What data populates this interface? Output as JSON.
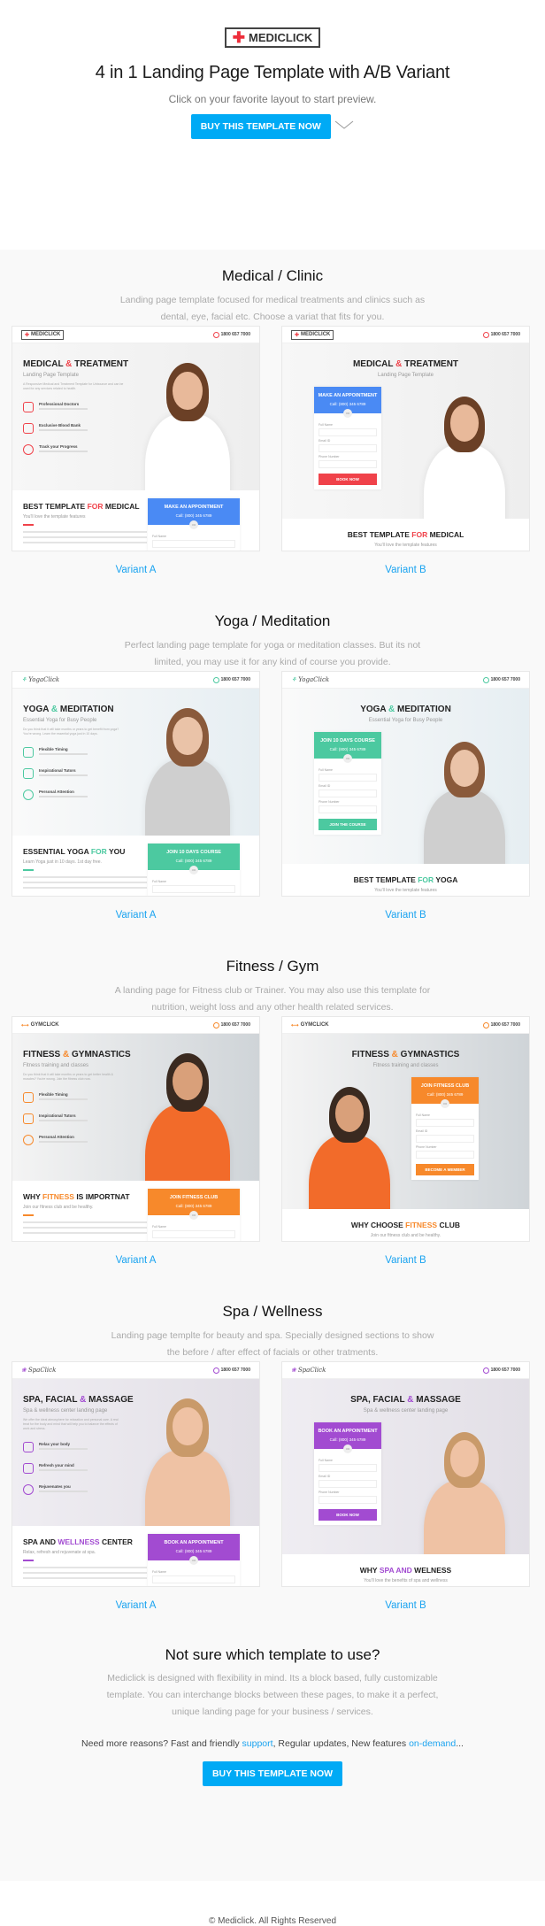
{
  "header": {
    "logo": "MEDICLICK",
    "title": "4 in 1 Landing Page Template with A/B Variant",
    "subtitle": "Click on your favorite layout to start preview.",
    "cta": "BUY THIS TEMPLATE NOW",
    "scroll_icon": "chevron-down-icon"
  },
  "colors": {
    "button": "#00aaf5",
    "link": "#1aa3f0",
    "section_bg": "#f9f9f9"
  },
  "sections": [
    {
      "title": "Medical / Clinic",
      "desc": "Landing page template focused for medical treatments and clinics such as dental, eye, facial etc. Choose a variat that fits for you.",
      "accent": "#f0424a",
      "form_color": "#4a8af4",
      "button_color": "#f0424a",
      "logo": "MEDICLICK",
      "phone": "1800 657 7000",
      "hero_title": [
        "MEDICAL ",
        "&",
        " TREATMENT"
      ],
      "hero_sub": "Landing Page Template",
      "intro": "A Responsive Medical and Treatment Template for Unbounce and can be used for any services related to health.",
      "features": [
        "Professional Doctors",
        "Exclusive Blood Bank",
        "Track your Progress"
      ],
      "form": {
        "title": "MAKE AN APPOINTMENT",
        "call": "Call: (800) 345 6789",
        "or": "OR",
        "fields": [
          "Full Name",
          "Email ID",
          "Phone Number"
        ],
        "button": "BOOK NOW"
      },
      "variant_a": {
        "label": "Variant A",
        "bottom_title": [
          "BEST TEMPLATE ",
          "FOR",
          " MEDICAL"
        ],
        "bottom_sub": "You'll love the template features"
      },
      "variant_b": {
        "label": "Variant B",
        "bottom_title": [
          "BEST TEMPLATE ",
          "FOR",
          " MEDICAL"
        ],
        "bottom_sub": "You'll love the template features"
      }
    },
    {
      "title": "Yoga / Meditation",
      "desc": "Perfect landing page template for yoga or meditation classes. But its not limited, you may use it for any kind of course you provide.",
      "accent": "#4cc9a0",
      "form_color": "#4cc9a0",
      "button_color": "#4cc9a0",
      "logo": "YogaClick",
      "phone": "1800 657 7000",
      "hero_title": [
        "YOGA ",
        "&",
        " MEDITATION"
      ],
      "hero_sub": "Essential Yoga for Busy People",
      "intro": "Do you think that it will take months or years to get benefit from yoga? You're wrong. Learn the essential yoga just in 10 days.",
      "features": [
        "Flexible Timing",
        "Inspirational Tutors",
        "Personal Attention"
      ],
      "form": {
        "title": "JOIN 10 DAYS COURSE",
        "call": "Call: (800) 345 6789",
        "or": "OR",
        "fields": [
          "Full Name",
          "Email ID",
          "Phone Number"
        ],
        "button": "JOIN THE COURSE"
      },
      "variant_a": {
        "label": "Variant A",
        "bottom_title": [
          "ESSENTIAL YOGA ",
          "FOR",
          " YOU"
        ],
        "bottom_sub": "Learn Yoga just in 10 days. 1st day free."
      },
      "variant_b": {
        "label": "Variant B",
        "bottom_title": [
          "BEST TEMPLATE ",
          "FOR",
          " YOGA"
        ],
        "bottom_sub": "You'll love the template features"
      }
    },
    {
      "title": "Fitness / Gym",
      "desc": "A landing page for Fitness club or Trainer. You may also use this template for nutrition, weight loss and any other health related services.",
      "accent": "#f7892b",
      "form_color": "#f7892b",
      "button_color": "#f7892b",
      "logo": "GYMCLICK",
      "phone": "1800 657 7000",
      "hero_title": [
        "FITNESS ",
        "&",
        " GYMNASTICS"
      ],
      "hero_sub": "Fitness training and classes",
      "intro": "Do you think that it will take months or years to get better health & muscles? You're wrong. Join the fitness club now.",
      "features": [
        "Flexible Timing",
        "Inspirational Tutors",
        "Personal Attention"
      ],
      "form": {
        "title": "JOIN FITNESS CLUB",
        "call": "Call: (800) 345 6789",
        "or": "OR",
        "fields": [
          "Full Name",
          "Email ID",
          "Phone Number"
        ],
        "button": "BECOME A MEMBER"
      },
      "variant_a": {
        "label": "Variant A",
        "bottom_title": [
          "WHY ",
          "FITNESS",
          " IS IMPORTNAT"
        ],
        "bottom_sub": "Join our fitness club and be healthy."
      },
      "variant_b": {
        "label": "Variant B",
        "bottom_title": [
          "WHY CHOOSE ",
          "FITNESS",
          " CLUB"
        ],
        "bottom_sub": "Join our fitness club and be healthy."
      }
    },
    {
      "title": "Spa / Wellness",
      "desc": "Landing page templte for beauty and spa. Specially designed sections to show the before / after effect of facials or other tratments.",
      "accent": "#a24bd1",
      "form_color": "#a24bd1",
      "button_color": "#a24bd1",
      "logo": "SpaClick",
      "phone": "1800 657 7000",
      "hero_title": [
        "SPA, FACIAL ",
        "&",
        " MASSAGE"
      ],
      "hero_sub": "Spa & wellness center landing page",
      "intro": "We offer the ideal atmosphere for relaxation and personal care. A real treat for the body and mind that will help you to balance the effects of work and stress.",
      "features": [
        "Relax your body",
        "Refresh your mind",
        "Rejuvenates you"
      ],
      "form": {
        "title": "BOOK AN APPOINTMENT",
        "call": "Call: (800) 345 6789",
        "or": "OR",
        "fields": [
          "Full Name",
          "Email ID",
          "Phone Number"
        ],
        "button": "BOOK NOW"
      },
      "variant_a": {
        "label": "Variant A",
        "bottom_title": [
          "SPA AND ",
          "WELLNESS",
          " CENTER"
        ],
        "bottom_sub": "Relax, refresh and rejuvenate at spa."
      },
      "variant_b": {
        "label": "Variant B",
        "bottom_title": [
          "WHY ",
          "SPA AND",
          " WELNESS"
        ],
        "bottom_sub": "You'll love the benefits of spa and wellness"
      }
    }
  ],
  "closing": {
    "title": "Not sure which template to use?",
    "desc": "Mediclick is designed with flexibility in mind. Its a block based, fully customizable template. You can interchange blocks between these pages, to make it a perfect, unique landing page for your business / services.",
    "reasons_pre": "Need more reasons? Fast and friendly ",
    "support_link": "support",
    "reasons_mid": ", Regular updates, New features ",
    "ondemand_link": "on-demand",
    "reasons_post": "...",
    "cta": "BUY THIS TEMPLATE NOW"
  },
  "footer": {
    "copyright": "© Mediclick. All Rights Reserved"
  }
}
